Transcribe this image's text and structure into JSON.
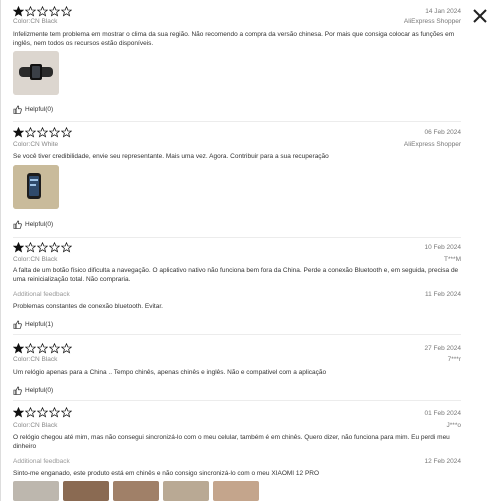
{
  "close_icon": "close-icon",
  "star_colors": {
    "filled": "#111111",
    "empty": "#ffffff"
  },
  "reviews": [
    {
      "date": "14 Jan 2024",
      "author": "AliExpress Shopper",
      "color": "Color:CN Black",
      "text": "Infelizmente tem problema em mostrar o clima da sua região. Não recomendo a compra da versão chinesa. Por mais que consiga colocar as funções em inglês, nem todos os recursos estão disponíveis.",
      "helpful": "Helpful(0)"
    },
    {
      "date": "06 Feb 2024",
      "author": "AliExpress Shopper",
      "color": "Color:CN White",
      "text": "Se você tiver credibilidade, envie seu representante. Mais uma vez. Agora. Contribuir para a sua recuperação",
      "helpful": "Helpful(0)"
    },
    {
      "date": "10 Feb 2024",
      "author": "T***M",
      "color": "Color:CN Black",
      "text": "A falta de um botão físico dificulta a navegação. O aplicativo nativo não funciona bem fora da China. Perde a conexão Bluetooth e, em seguida, precisa de uma reinicialização total. Não compraria.",
      "additional_label": "Additional feedback",
      "additional_date": "11 Feb 2024",
      "additional_text": "Problemas constantes de conexão bluetooth. Evitar.",
      "helpful": "Helpful(1)"
    },
    {
      "date": "27 Feb 2024",
      "author": "7***r",
      "color": "Color:CN Black",
      "text": "Um relógio apenas para a China .. Tempo chinês, apenas chinês e inglês. Não e compativel com a aplicação",
      "helpful": "Helpful(0)"
    },
    {
      "date": "01 Feb 2024",
      "author": "J***o",
      "color": "Color:CN Black",
      "text": "O relógio chegou até mim, mas não consegui sincronizá-lo com o meu celular, também é em chinês. Quero dizer, não funciona para mim. Eu perdi meu dinheiro",
      "additional_label": "Additional feedback",
      "additional_date": "12 Feb 2024",
      "additional_text": "Sinto-me enganado, este produto está em chinês e não consigo sincronizá-lo com o meu XIAOMI 12 PRO"
    }
  ]
}
